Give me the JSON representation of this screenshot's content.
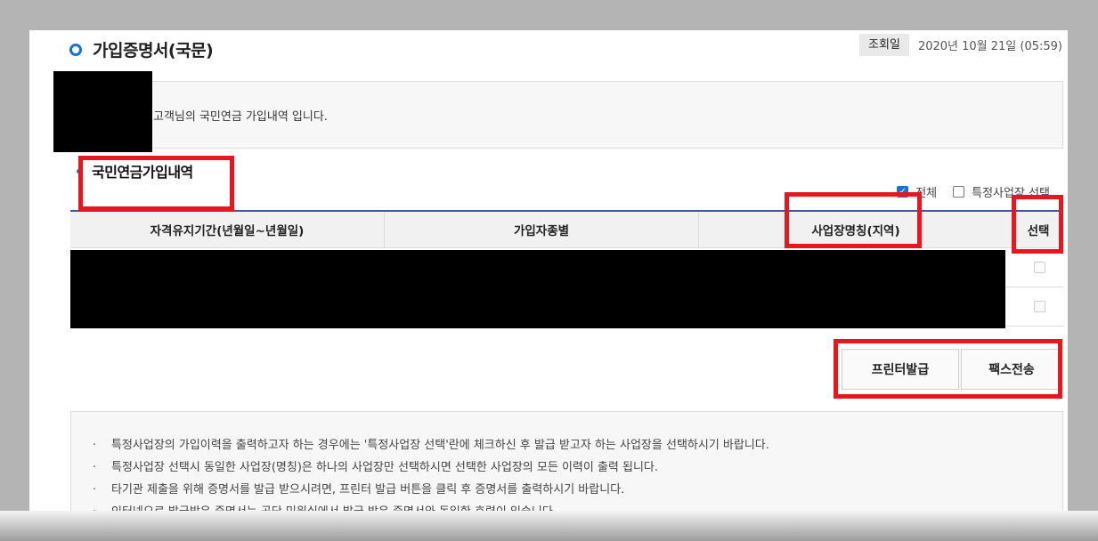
{
  "page": {
    "title": "가입증명서(국문)",
    "query_label": "조회일",
    "query_value": "2020년 10월 21일 (05:59)"
  },
  "info": {
    "text": "고객님의 국민연금 가입내역 입니다."
  },
  "section": {
    "title": "국민연금가입내역",
    "filter_all": "전체",
    "filter_all_checked": true,
    "filter_specific": "특정사업장 선택",
    "filter_specific_checked": false
  },
  "table": {
    "columns": [
      "자격유지기간(년월일~년월일)",
      "가입자종별",
      "사업장명칭(지역)",
      "선택"
    ],
    "row_count": 2
  },
  "buttons": {
    "print": "프린터발급",
    "fax": "팩스전송"
  },
  "notes": [
    "특정사업장의 가입이력을 출력하고자 하는 경우에는 '특정사업장 선택'란에 체크하신 후 발급 받고자 하는 사업장을 선택하시기 바랍니다.",
    "특정사업장 선택시 동일한 사업장(명칭)은 하나의 사업장만 선택하시면 선택한 사업장의 모든 이력이 출력 됩니다.",
    "타기관 제출을 위해 증명서를 발급 받으시려면, 프린터 발급 버튼을 클릭 후 증명서를 출력하시기 바랍니다.",
    "인터넷으로 발급받은 증명서는 공단 민원실에서 발급 받은 증명서와 동일한 효력이 있습니다."
  ],
  "colors": {
    "accent": "#1a6fd6",
    "highlight": "#e8161f",
    "table_border": "#44559a",
    "redaction": "#000000"
  },
  "icons": {
    "title_bullet": "ring-bullet-icon",
    "section_bullet": "dot-bullet-icon",
    "note_bullet": "dot-bullet"
  }
}
